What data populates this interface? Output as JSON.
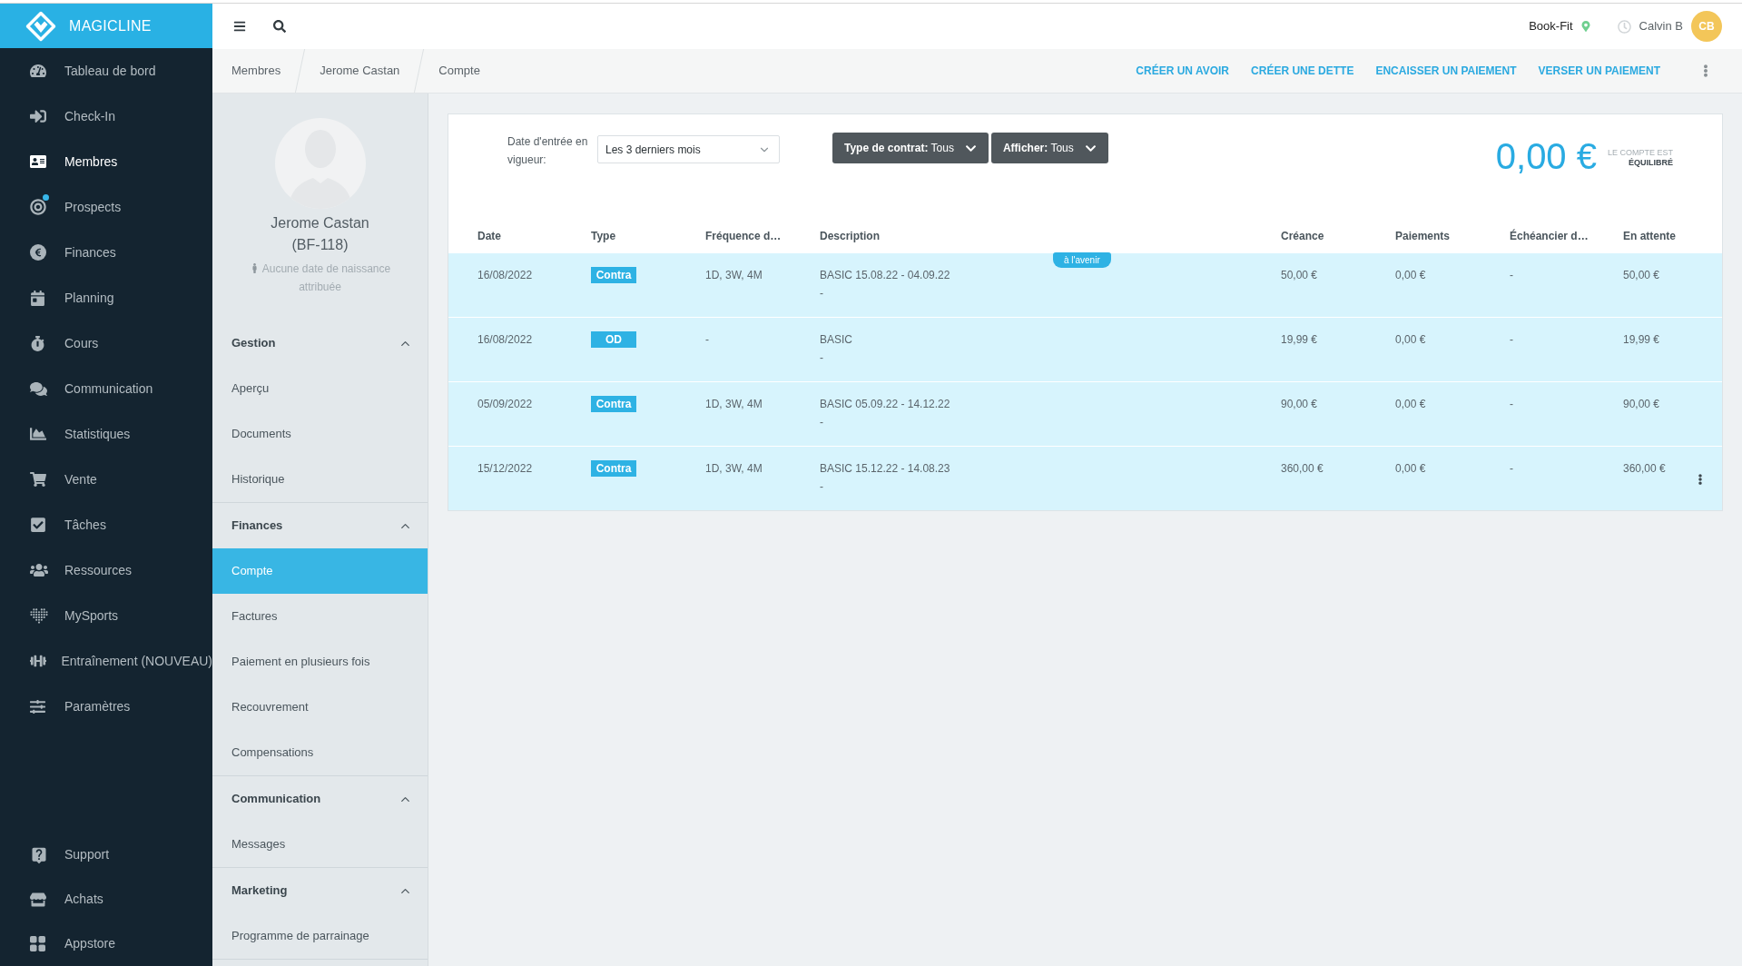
{
  "brand": {
    "name": "MAGICLINE"
  },
  "nav": {
    "items": [
      {
        "label": "Tableau de bord",
        "selected": false,
        "notification": false
      },
      {
        "label": "Check-In",
        "selected": false,
        "notification": false
      },
      {
        "label": "Membres",
        "selected": true,
        "notification": false
      },
      {
        "label": "Prospects",
        "selected": false,
        "notification": true
      },
      {
        "label": "Finances",
        "selected": false,
        "notification": false
      },
      {
        "label": "Planning",
        "selected": false,
        "notification": false
      },
      {
        "label": "Cours",
        "selected": false,
        "notification": false
      },
      {
        "label": "Communication",
        "selected": false,
        "notification": false
      },
      {
        "label": "Statistiques",
        "selected": false,
        "notification": false
      },
      {
        "label": "Vente",
        "selected": false,
        "notification": false
      },
      {
        "label": "Tâches",
        "selected": false,
        "notification": false
      },
      {
        "label": "Ressources",
        "selected": false,
        "notification": false
      },
      {
        "label": "MySports",
        "selected": false,
        "notification": false
      },
      {
        "label": "Entraînement (NOUVEAU)",
        "selected": false,
        "notification": false
      },
      {
        "label": "Paramètres",
        "selected": false,
        "notification": false
      }
    ],
    "bottom_items": [
      {
        "label": "Support",
        "selected": false
      },
      {
        "label": "Achats",
        "selected": false
      },
      {
        "label": "Appstore",
        "selected": false
      }
    ]
  },
  "topbar": {
    "location": "Book-Fit",
    "user": "Calvin B",
    "avatar_initials": "CB"
  },
  "breadcrumb": [
    "Membres",
    "Jerome Castan",
    "Compte"
  ],
  "actions": [
    "CRÉER UN AVOIR",
    "CRÉER UNE DETTE",
    "ENCAISSER UN PAIEMENT",
    "VERSER UN PAIEMENT"
  ],
  "member": {
    "name": "Jerome Castan",
    "id": "(BF-118)",
    "birthdate_note": "Aucune date de naissance attribuée"
  },
  "member_menu": [
    {
      "title": "Gestion",
      "expanded": true,
      "items": [
        {
          "label": "Aperçu",
          "selected": false
        },
        {
          "label": "Documents",
          "selected": false
        },
        {
          "label": "Historique",
          "selected": false
        }
      ]
    },
    {
      "title": "Finances",
      "expanded": true,
      "items": [
        {
          "label": "Compte",
          "selected": true
        },
        {
          "label": "Factures",
          "selected": false
        },
        {
          "label": "Paiement en plusieurs fois",
          "selected": false
        },
        {
          "label": "Recouvrement",
          "selected": false
        },
        {
          "label": "Compensations",
          "selected": false
        }
      ]
    },
    {
      "title": "Communication",
      "expanded": true,
      "items": [
        {
          "label": "Messages",
          "selected": false
        }
      ]
    },
    {
      "title": "Marketing",
      "expanded": true,
      "items": [
        {
          "label": "Programme de parrainage",
          "selected": false
        }
      ]
    }
  ],
  "filters": {
    "date_label": "Date d'entrée en vigueur:",
    "date_value": "Les 3 derniers mois",
    "buttons": [
      {
        "label": "Type de contrat:",
        "value": "Tous"
      },
      {
        "label": "Afficher:",
        "value": "Tous"
      }
    ]
  },
  "balance": {
    "amount": "0,00 €",
    "status_line_1": "LE COMPTE EST",
    "status_line_2": "ÉQUILIBRÉ"
  },
  "table": {
    "columns": [
      "Date",
      "Type",
      "Fréquence d…",
      "Description",
      "Créance",
      "Paiements",
      "Échéancier d…",
      "En attente"
    ],
    "rows": [
      {
        "date": "16/08/2022",
        "type": "Contra",
        "frequency": "1D, 3W, 4M",
        "description": "BASIC 15.08.22 - 04.09.22",
        "description_note": "-",
        "tag": "à l'avenir",
        "claim": "50,00 €",
        "payments": "0,00 €",
        "schedule": "-",
        "pending": "50,00 €",
        "actions_visible": false
      },
      {
        "date": "16/08/2022",
        "type": "OD",
        "frequency": "-",
        "description": "BASIC",
        "description_note": "-",
        "claim": "19,99 €",
        "payments": "0,00 €",
        "schedule": "-",
        "pending": "19,99 €",
        "actions_visible": false
      },
      {
        "date": "05/09/2022",
        "type": "Contra",
        "frequency": "1D, 3W, 4M",
        "description": "BASIC 05.09.22 - 14.12.22",
        "description_note": "-",
        "claim": "90,00 €",
        "payments": "0,00 €",
        "schedule": "-",
        "pending": "90,00 €",
        "actions_visible": false
      },
      {
        "date": "15/12/2022",
        "type": "Contra",
        "frequency": "1D, 3W, 4M",
        "description": "BASIC 15.12.22 - 14.08.23",
        "description_note": "-",
        "claim": "360,00 €",
        "payments": "0,00 €",
        "schedule": "-",
        "pending": "360,00 €",
        "actions_visible": true
      }
    ]
  }
}
